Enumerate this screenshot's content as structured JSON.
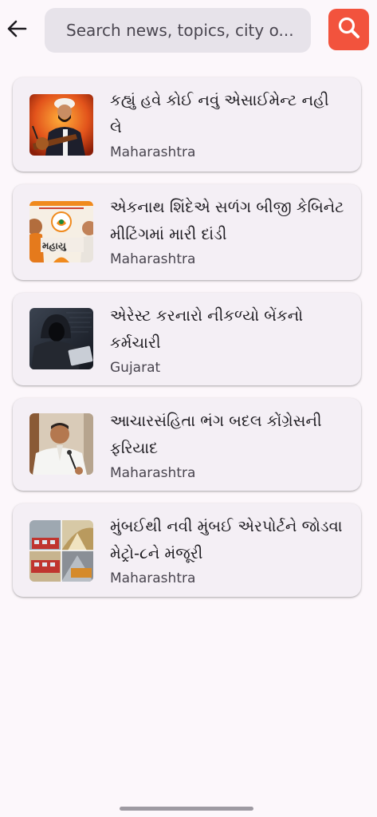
{
  "search": {
    "placeholder": "Search news, topics, city o..."
  },
  "articles": [
    {
      "title": "કહ્યું હવે કોઈ નવું એસાઈમેન્ટ નહી લે",
      "region": "Maharashtra"
    },
    {
      "title": "એકનાથ શિંદેએ સળંગ બીજી કેબિનેટ મીટિંગમાં મારી દાંડી",
      "region": "Maharashtra"
    },
    {
      "title": "એરેસ્ટ કરનારો નીકળ્યો બેંકનો કર્મચારી",
      "region": "Gujarat"
    },
    {
      "title": "આચારસંહિતા ભંગ બદલ કોંગ્રેસની ફરિયાદ",
      "region": "Maharashtra"
    },
    {
      "title": "મુંબઈથી નવી  મુંબઈ એરપોર્ટને જોડવા મેટ્રો-૮ને મંજૂરી",
      "region": "Maharashtra"
    }
  ],
  "thumb_text": {
    "thumb2_caption": "મહાયુ"
  },
  "colors": {
    "background": "#fcf7fb",
    "card": "#f4eff5",
    "search_field": "#e7e3ea",
    "accent_search_button": "#f2533d"
  },
  "icons": {
    "back": "arrow-left",
    "search": "magnifier"
  }
}
